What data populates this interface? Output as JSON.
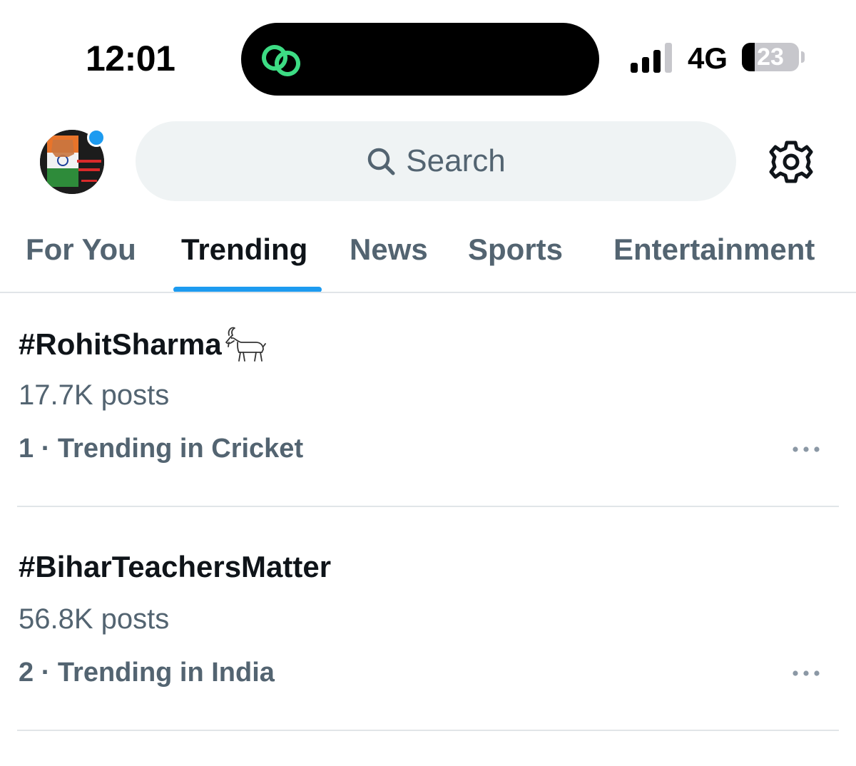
{
  "status_bar": {
    "time": "12:01",
    "network": "4G",
    "battery_level": "23",
    "battery_fraction": 0.23,
    "signal_bars_active": 3,
    "signal_bars_total": 4
  },
  "header": {
    "search_placeholder": "Search",
    "avatar_icon": "profile-avatar",
    "settings_icon": "gear-icon",
    "notification_dot": true
  },
  "tabs": [
    {
      "label": "For You",
      "active": false
    },
    {
      "label": "Trending",
      "active": true
    },
    {
      "label": "News",
      "active": false
    },
    {
      "label": "Sports",
      "active": false
    },
    {
      "label": "Entertainment",
      "active": false
    }
  ],
  "trends": [
    {
      "name": "#RohitSharma",
      "emoji_icon": "goat-icon",
      "posts": "17.7K posts",
      "rank": "1",
      "context": "Trending in Cricket"
    },
    {
      "name": "#BiharTeachersMatter",
      "posts": "56.8K posts",
      "rank": "2",
      "context": "Trending in India"
    }
  ],
  "colors": {
    "accent": "#1d9bf0",
    "text_primary": "#0f1419",
    "text_secondary": "#536471",
    "search_bg": "#eff3f4",
    "divider": "#e1e5e8",
    "island_icon": "#3ddc84"
  }
}
